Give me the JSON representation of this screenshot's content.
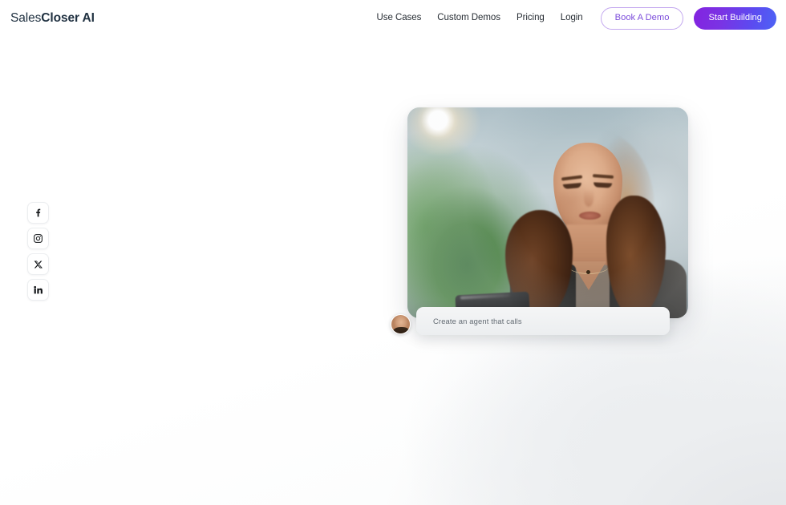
{
  "brand": {
    "name_light": "Sales",
    "name_bold": "Closer AI"
  },
  "nav": {
    "links": [
      {
        "label": "Use Cases",
        "name": "nav-use-cases"
      },
      {
        "label": "Custom Demos",
        "name": "nav-custom-demos"
      },
      {
        "label": "Pricing",
        "name": "nav-pricing"
      },
      {
        "label": "Login",
        "name": "nav-login"
      }
    ],
    "demo_button": "Book A Demo",
    "build_button": "Start Building",
    "accent_outline": "#7c4ddb",
    "accent_gradient_from": "#8323e0",
    "accent_gradient_to": "#4d63f5"
  },
  "social": {
    "items": [
      {
        "label": "Facebook",
        "icon": "facebook-icon"
      },
      {
        "label": "Instagram",
        "icon": "instagram-icon"
      },
      {
        "label": "X",
        "icon": "x-twitter-icon"
      },
      {
        "label": "LinkedIn",
        "icon": "linkedin-icon"
      }
    ]
  },
  "hero": {
    "image_alt": "Woman with long wavy brown hair looking down at a phone in a bright blurred office",
    "caption": "Create an agent that calls",
    "avatar_alt": "Circular profile photo of a smiling woman"
  }
}
